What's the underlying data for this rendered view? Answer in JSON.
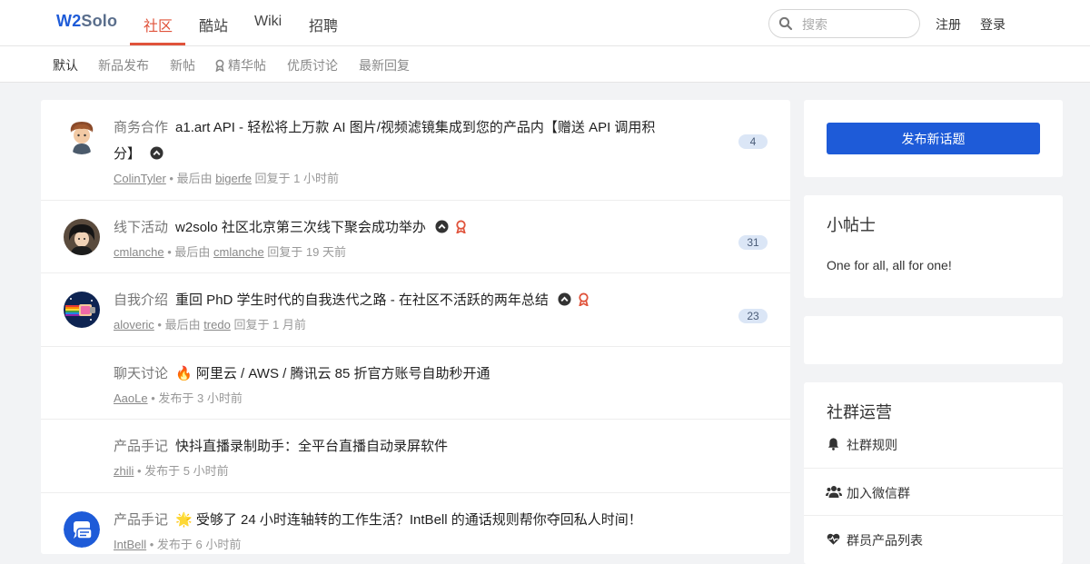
{
  "brand": {
    "w2": "W2",
    "solo": "Solo"
  },
  "nav": {
    "items": [
      "社区",
      "酷站",
      "Wiki",
      "招聘"
    ]
  },
  "search": {
    "placeholder": "搜索"
  },
  "auth": {
    "register": "注册",
    "login": "登录"
  },
  "subnav": {
    "items": [
      "默认",
      "新品发布",
      "新帖",
      "精华帖",
      "优质讨论",
      "最新回复"
    ]
  },
  "topics": [
    {
      "node": "商务合作",
      "title": "a1.art API - 轻松将上万款 AI 图片/视频滤镜集成到您的产品内【赠送 API 调用积",
      "title_cont": "分】",
      "author": "ColinTyler",
      "sep": " • 最后由 ",
      "last": "bigerfe",
      "time": " 回复于 1 小时前",
      "count": "4"
    },
    {
      "node": "线下活动",
      "title": "w2solo 社区北京第三次线下聚会成功举办",
      "author": "cmlanche",
      "sep": " • 最后由 ",
      "last": "cmlanche",
      "time": " 回复于 19 天前",
      "count": "31"
    },
    {
      "node": "自我介绍",
      "title": "重回 PhD 学生时代的自我迭代之路 - 在社区不活跃的两年总结",
      "author": "aloveric",
      "sep": " • 最后由 ",
      "last": "tredo",
      "time": " 回复于 1 月前",
      "count": "23"
    },
    {
      "node": "聊天讨论",
      "title": "🔥 阿里云 / AWS / 腾讯云 85 折官方账号自助秒开通",
      "author": "AaoLe",
      "time": " • 发布于 3 小时前"
    },
    {
      "node": "产品手记",
      "title": "快抖直播录制助手：全平台直播自动录屏软件",
      "author": "zhili",
      "time": " • 发布于 5 小时前"
    },
    {
      "node": "产品手记",
      "title": "🌟 受够了 24 小时连轴转的工作生活？IntBell 的通话规则帮你夺回私人时间！",
      "author": "IntBell",
      "time": " • 发布于 6 小时前"
    }
  ],
  "sidebar": {
    "new_topic": "发布新话题",
    "tips_title": "小帖士",
    "tips_text": "One for all, all for one!",
    "ops_title": "社群运营",
    "links": [
      "社群规则",
      "加入微信群",
      "群员产品列表"
    ]
  },
  "colors": {
    "accent": "#e0533b",
    "primary": "#1e5bd8",
    "badge_bg": "#dbe6f6"
  }
}
